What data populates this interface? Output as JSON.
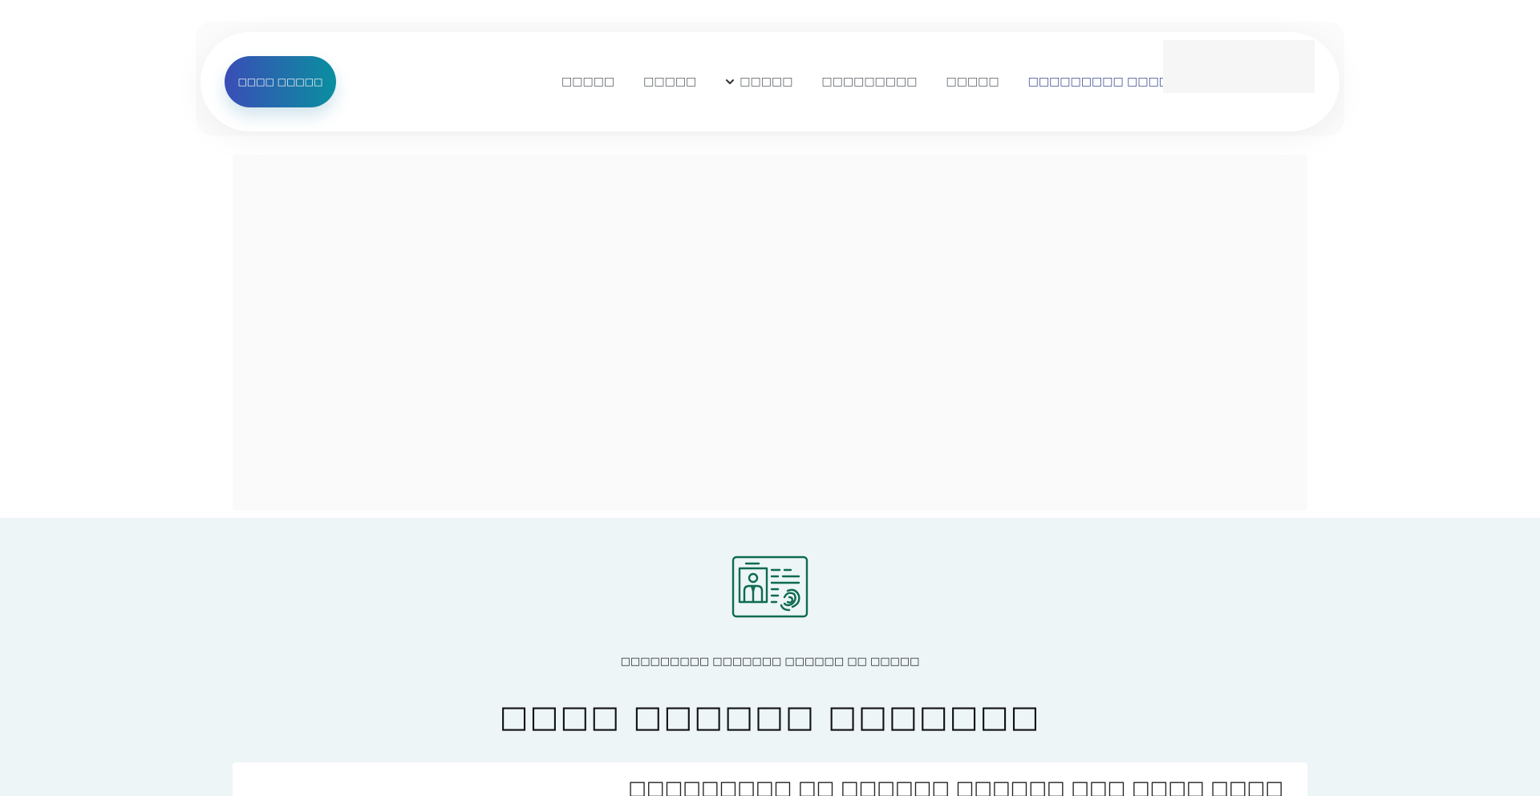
{
  "header": {
    "cta_label": "□□□□ □□□□□",
    "nav_items": [
      {
        "label": "□□□□□"
      },
      {
        "label": "□□□□□"
      },
      {
        "label": "□□□□□"
      },
      {
        "label": "□□□□□□□□□"
      },
      {
        "label": "□□□□□"
      },
      {
        "label": "□□□□□□□□□ □□□□□□□"
      }
    ]
  },
  "section": {
    "subtitle": "□□□□□□□□□ □□□□□□□ □□□□□□ □□ □□□□□",
    "title": "□□□□ □□□□□□ □□□□□□□",
    "card_heading": "□□□□□□□□□ □□ □□□□□□ □□□□□□ □□□ □□□□ □□□□"
  },
  "colors": {
    "cta_gradient_start": "#3a4db7",
    "cta_gradient_end": "#0a8f9f",
    "section_background": "#edf5f6",
    "icon_color": "#0e6b4e",
    "active_nav_color": "#3a4a8f"
  }
}
